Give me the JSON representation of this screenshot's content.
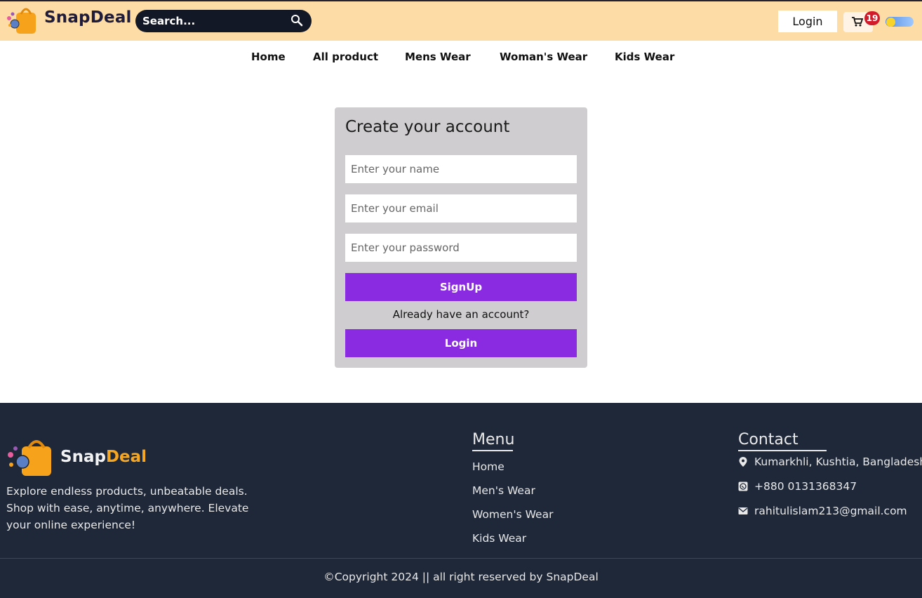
{
  "header": {
    "brand": "SnapDeal",
    "search_placeholder": "Search...",
    "login_label": "Login",
    "cart_count": "19"
  },
  "nav": {
    "items": [
      "Home",
      "All product",
      "Mens Wear",
      "Woman's Wear",
      "Kids Wear"
    ]
  },
  "signup": {
    "title": "Create your account",
    "name_placeholder": "Enter your name",
    "email_placeholder": "Enter your email",
    "password_placeholder": "Enter your password",
    "signup_label": "SignUp",
    "already_text": "Already have an account?",
    "login_label": "Login"
  },
  "footer": {
    "brand_part1": "Snap",
    "brand_part2": "Deal",
    "description": "Explore endless products, unbeatable deals. Shop with ease, anytime, anywhere. Elevate your online experience!",
    "menu_heading": "Menu",
    "menu_items": [
      "Home",
      "Men's Wear",
      "Women's Wear",
      "Kids Wear"
    ],
    "contact_heading": "Contact",
    "address": "Kumarkhli, Kushtia, Bangladesh",
    "phone": "+880 0131368347",
    "email": "rahitulislam213@gmail.com",
    "copyright": "©Copyright 2024 || all right reserved by SnapDeal"
  },
  "colors": {
    "header_bg": "#fddca6",
    "accent_purple": "#8a2be2",
    "footer_bg": "#1e2839",
    "brand_orange": "#f5a623",
    "badge_red": "#d11a2a"
  },
  "icons": [
    "shopping-bag-logo-icon",
    "search-icon",
    "cart-icon",
    "theme-toggle-icon",
    "location-pin-icon",
    "whatsapp-icon",
    "mail-icon"
  ]
}
